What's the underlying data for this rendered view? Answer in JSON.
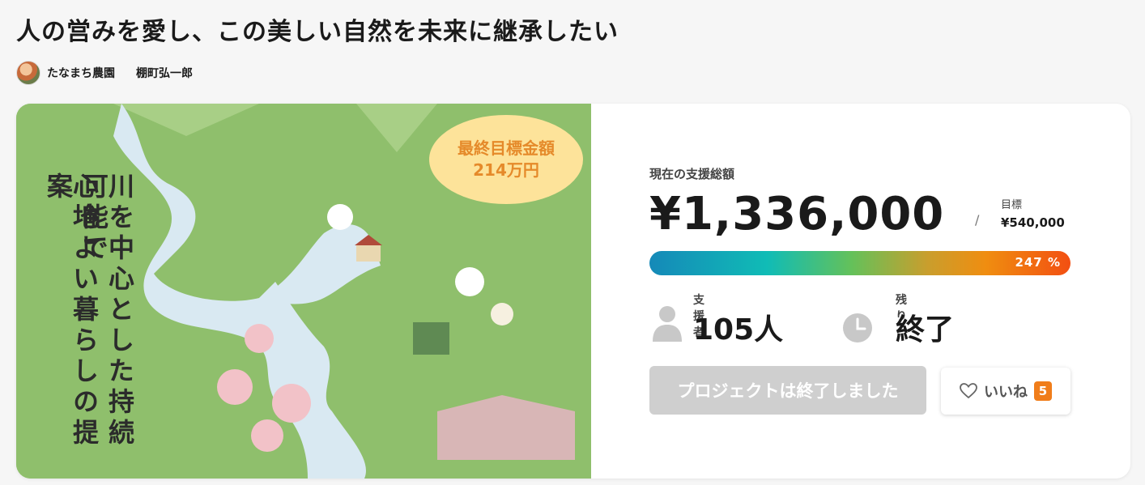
{
  "project": {
    "title": "人の営みを愛し、この美しい自然を未来に継承したい",
    "owner_org": "たなまち農園",
    "owner_name": "棚町弘一郎"
  },
  "hero": {
    "vertical_text_right": "川を中心とした持続可能で",
    "vertical_text_left": "心地よい暮らしの提案",
    "badge_line1": "最終目標金額",
    "badge_line2": "214万円"
  },
  "funding": {
    "raised_label": "現在の支援総額",
    "raised_amount": "¥1,336,000",
    "goal_slash": "/",
    "goal_label": "目標",
    "goal_amount": "¥540,000",
    "progress_text": "247 %",
    "progress_percent": 247
  },
  "stats": {
    "supporters_label": "支援者",
    "supporters_value": "105人",
    "remaining_label": "残り",
    "remaining_value": "終了"
  },
  "actions": {
    "ended_button_label": "プロジェクトは終了しました",
    "like_label": "いいね",
    "like_count": "5"
  },
  "icons": {
    "owner_avatar": "avatar",
    "supporters": "person-icon",
    "remaining": "clock-icon",
    "like": "heart-icon"
  },
  "colors": {
    "accent_orange": "#f07d1a",
    "badge_bg": "#fde39a",
    "badge_text": "#e58a2a",
    "ended_button_bg": "#cfcfcf"
  }
}
